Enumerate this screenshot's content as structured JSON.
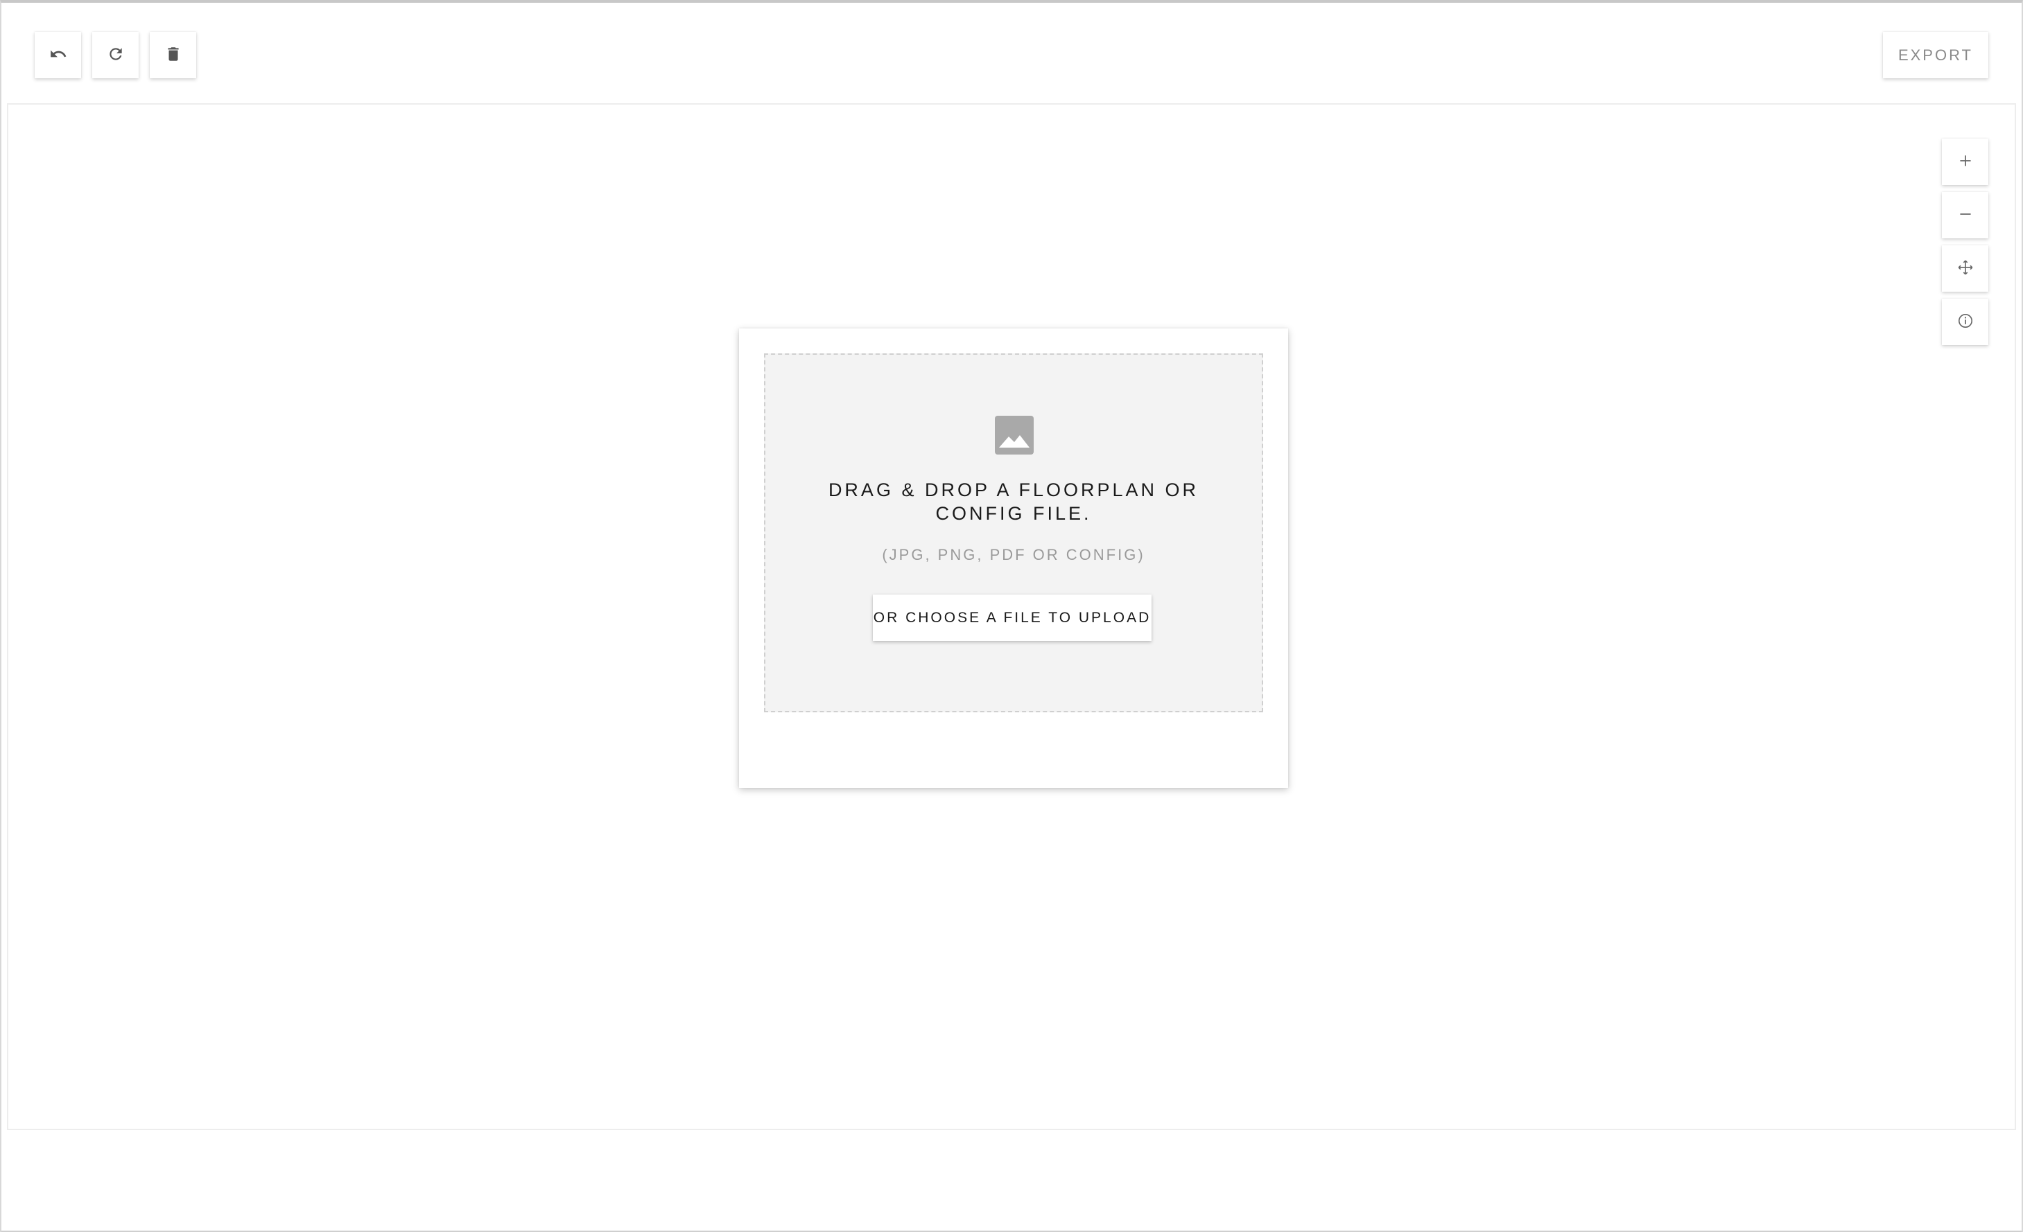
{
  "toolbar": {
    "undo_icon": "undo-icon",
    "redo_icon": "redo-icon",
    "delete_icon": "trash-icon",
    "export_label": "EXPORT"
  },
  "zoom_controls": {
    "zoom_in_icon": "plus-icon",
    "zoom_out_icon": "minus-icon",
    "fit_icon": "move-icon",
    "info_icon": "info-icon"
  },
  "upload": {
    "icon": "image-icon",
    "title": "DRAG & DROP A FLOORPLAN OR CONFIG FILE.",
    "subtitle": "(JPG, PNG, PDF OR CONFIG)",
    "choose_label": "OR CHOOSE A FILE TO UPLOAD"
  },
  "colors": {
    "icon_gray": "#555555",
    "dropzone_bg": "#f3f3f3",
    "muted_text": "#9a9a9a",
    "image_icon": "#a9a9a9"
  }
}
